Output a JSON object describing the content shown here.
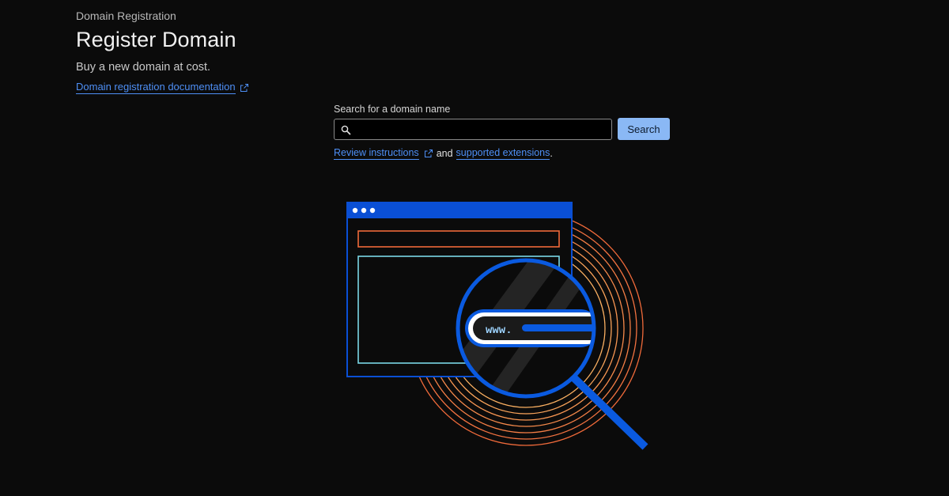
{
  "header": {
    "breadcrumb": "Domain Registration",
    "title": "Register Domain",
    "subtitle": "Buy a new domain at cost.",
    "doc_link": "Domain registration documentation"
  },
  "search": {
    "label": "Search for a domain name",
    "value": "",
    "placeholder": "",
    "button_label": "Search"
  },
  "help": {
    "instructions_link": "Review instructions",
    "connector": "and",
    "extensions_link": "supported extensions",
    "period": "."
  },
  "illustration": {
    "url_text": "www."
  },
  "icons": {
    "search": "search-icon",
    "external": "external-link-icon"
  },
  "colors": {
    "background": "#0b0b0b",
    "link": "#4e8ff5",
    "button": "#8ab8f5",
    "browser_blue": "#0a4fd4",
    "accent_orange": "#f06a3a",
    "accent_teal": "#7ad8e6"
  }
}
